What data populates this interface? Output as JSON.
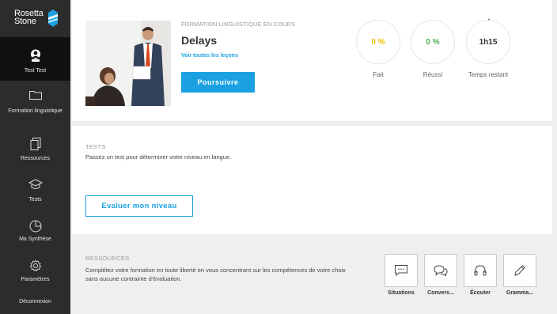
{
  "brand": {
    "line1": "Rosetta",
    "line2": "Stone"
  },
  "sidebar": {
    "items": [
      {
        "label": "Test Test",
        "icon": "user-icon"
      },
      {
        "label": "Formation linguistique",
        "icon": "folder-icon"
      },
      {
        "label": "Ressources",
        "icon": "documents-icon"
      },
      {
        "label": "Tests",
        "icon": "graduation-cap-icon"
      },
      {
        "label": "Ma Synthèse",
        "icon": "pie-chart-icon"
      },
      {
        "label": "Paramètres",
        "icon": "gear-icon"
      },
      {
        "label": "Déconnexion",
        "icon": ""
      }
    ]
  },
  "course": {
    "kicker": "FORMATION LINGUISTIQUE EN COURS",
    "title": "Delays",
    "link": "Voir toutes les leçons",
    "button": "Poursuivre"
  },
  "stats": [
    {
      "value": "0 %",
      "label": "Fait",
      "color": "#f2c500"
    },
    {
      "value": "0 %",
      "label": "Réussi",
      "color": "#4caf50"
    },
    {
      "value": "1h15",
      "label": "Temps restant",
      "color": "#333333"
    }
  ],
  "tests": {
    "kicker": "TESTS",
    "text": "Passez un test pour déterminer votre niveau en langue.",
    "button": "Evaluer mon niveau"
  },
  "resources": {
    "kicker": "RESSOURCES",
    "text1": "Complétez votre formation en toute liberté en vous concentrant sur les compétences de votre choix",
    "text2": "sans aucune contrainte d'évaluation.",
    "tiles": [
      {
        "label": "Situations",
        "icon": "chat-bubble-icon"
      },
      {
        "label": "Convers...",
        "icon": "conversation-icon"
      },
      {
        "label": "Écouter",
        "icon": "headphones-icon"
      },
      {
        "label": "Gramma...",
        "icon": "pencil-icon"
      }
    ]
  },
  "colors": {
    "accent": "#1ba1e2",
    "sidebar": "#2c2c2c",
    "sidebar_active": "#111111"
  }
}
